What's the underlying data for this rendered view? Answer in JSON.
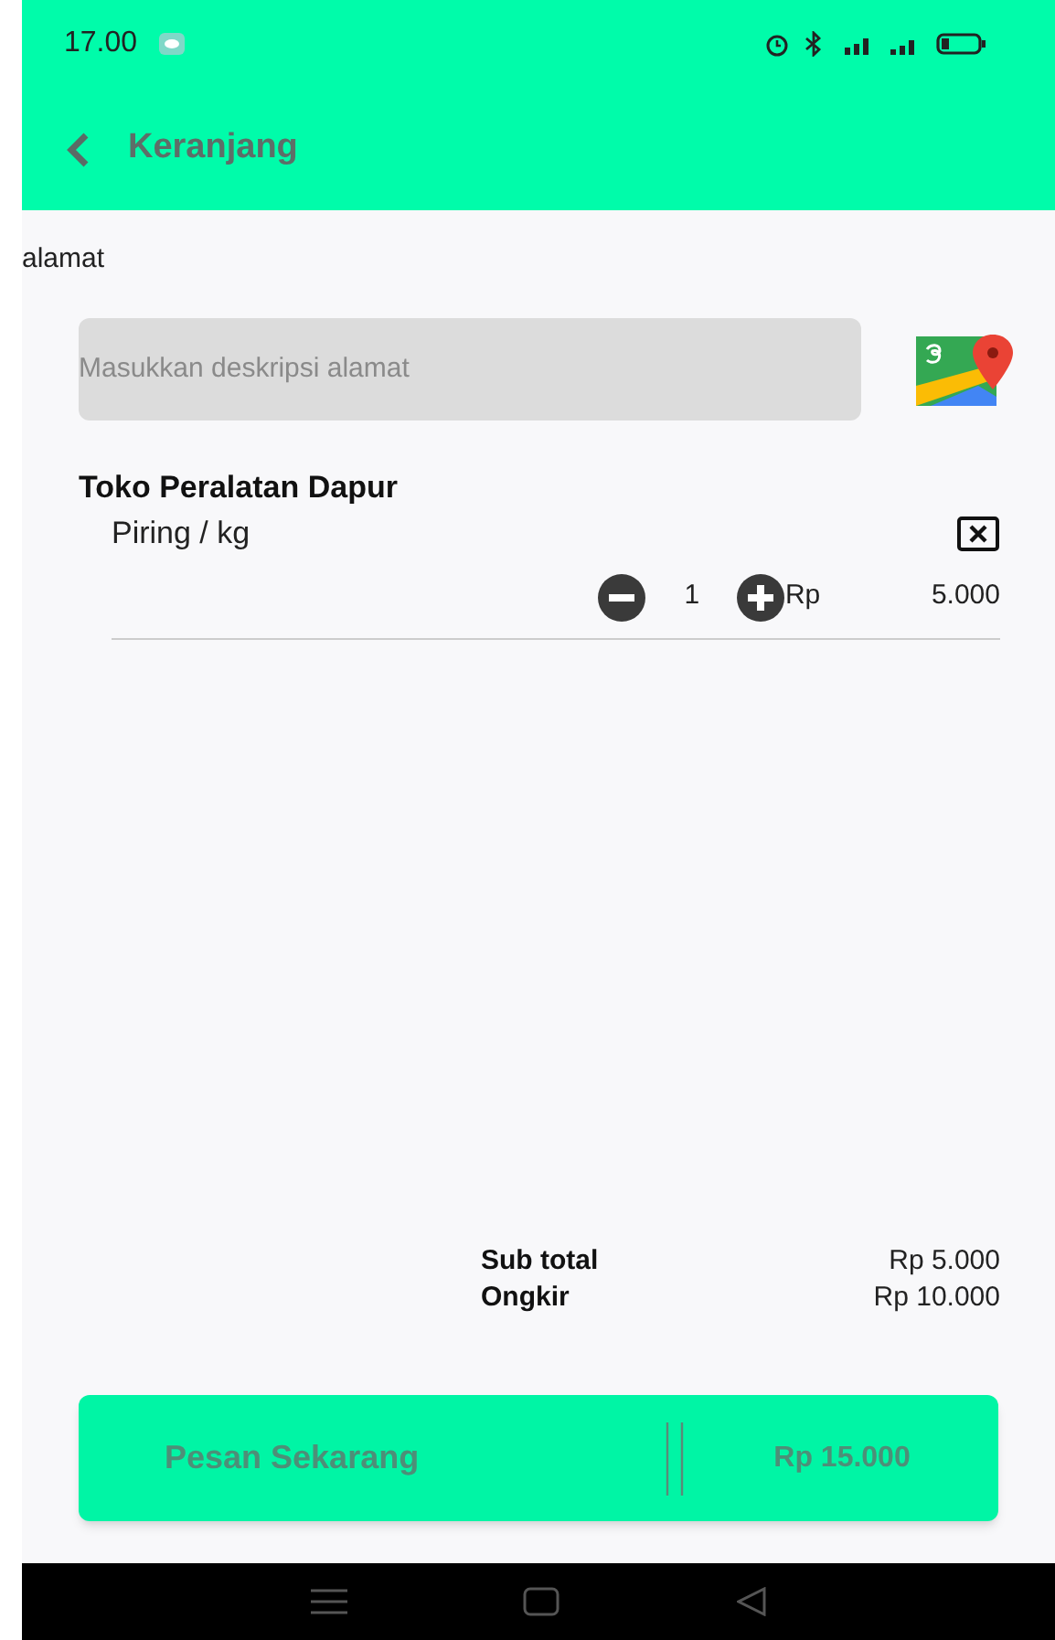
{
  "status_bar": {
    "time": "17.00"
  },
  "app_bar": {
    "title": "Keranjang"
  },
  "address": {
    "label": "alamat",
    "placeholder": "Masukkan deskripsi alamat"
  },
  "stores": [
    {
      "name": "Toko Peralatan Dapur",
      "items": [
        {
          "name": "Piring / kg",
          "quantity": "1",
          "currency": "Rp",
          "price": "5.000"
        }
      ]
    }
  ],
  "summary": [
    {
      "label": "Sub total",
      "value": "Rp 5.000"
    },
    {
      "label": "Ongkir",
      "value": "Rp 10.000"
    }
  ],
  "order_button": {
    "label": "Pesan Sekarang",
    "total": "Rp 15.000"
  }
}
